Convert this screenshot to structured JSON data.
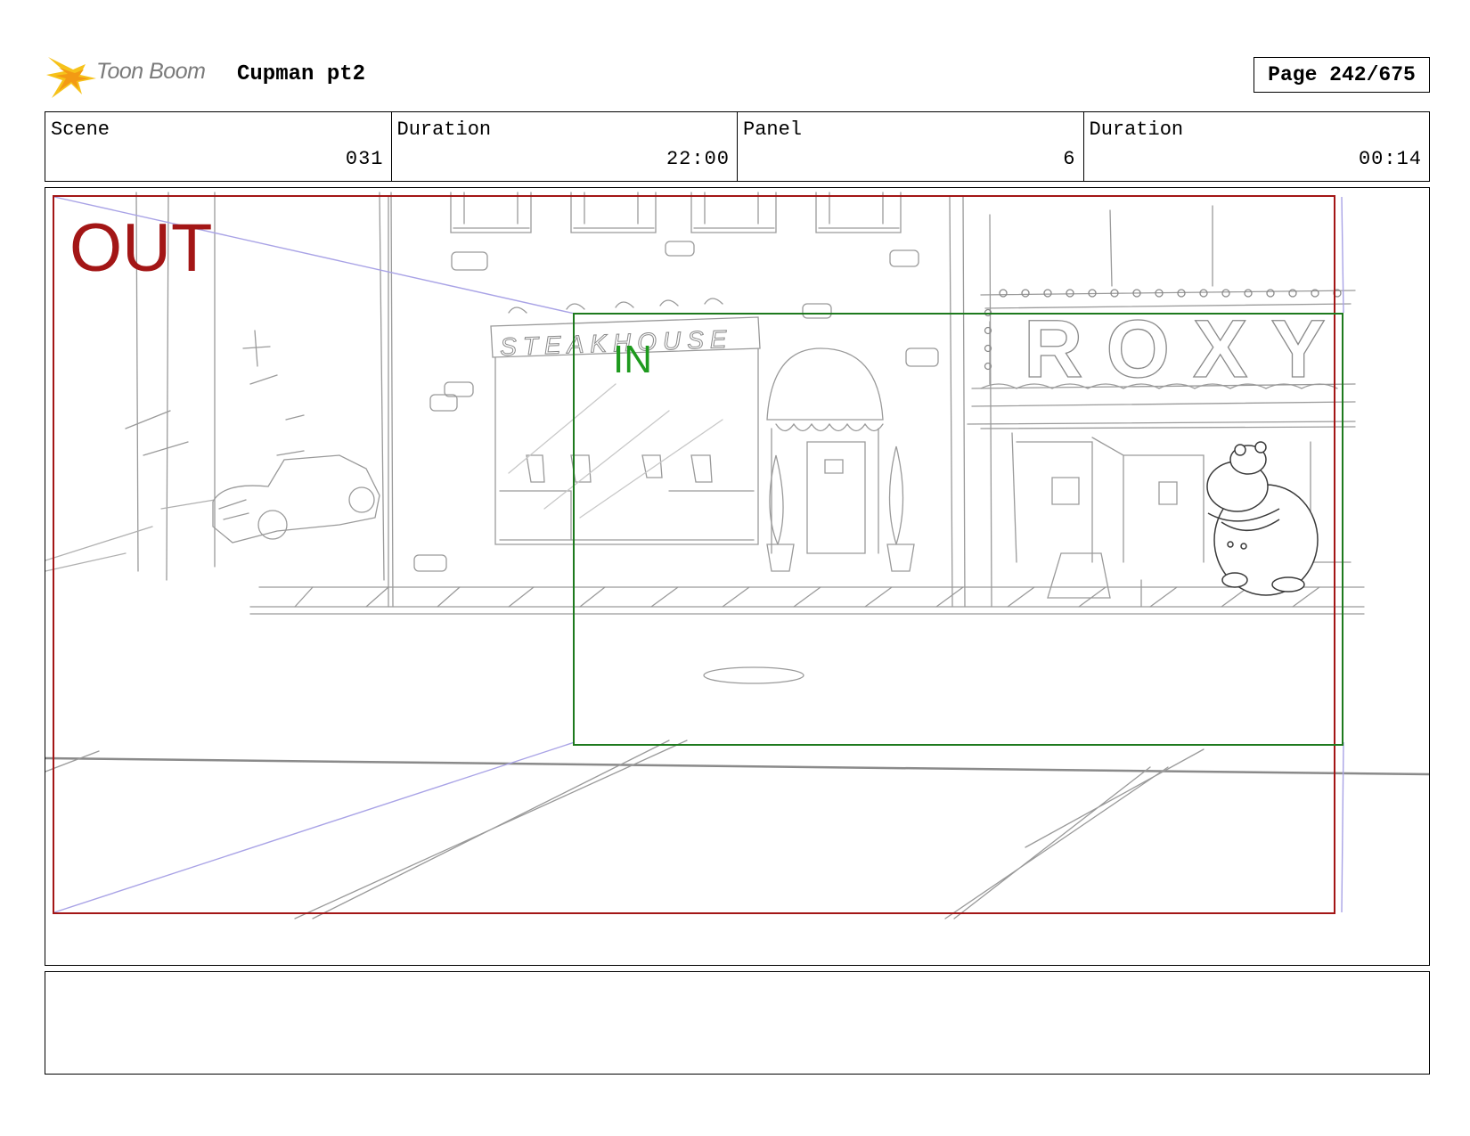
{
  "header": {
    "logo_text": "Toon Boom",
    "project_title": "Cupman pt2",
    "page_label": "Page 242/675"
  },
  "info": {
    "scene_label": "Scene",
    "scene_value": "031",
    "scene_duration_label": "Duration",
    "scene_duration_value": "22:00",
    "panel_label": "Panel",
    "panel_value": "6",
    "panel_duration_label": "Duration",
    "panel_duration_value": "00:14"
  },
  "panel": {
    "out_label": "OUT",
    "in_label": "IN",
    "sign_steakhouse": "STEAKHOUSE",
    "sign_roxy": "ROXY",
    "colors": {
      "out_frame": "#a31616",
      "in_frame": "#1e7a1e",
      "camera_path": "#a9a3e6",
      "sketch": "#8a8a8a"
    }
  },
  "notes": {
    "text": ""
  }
}
